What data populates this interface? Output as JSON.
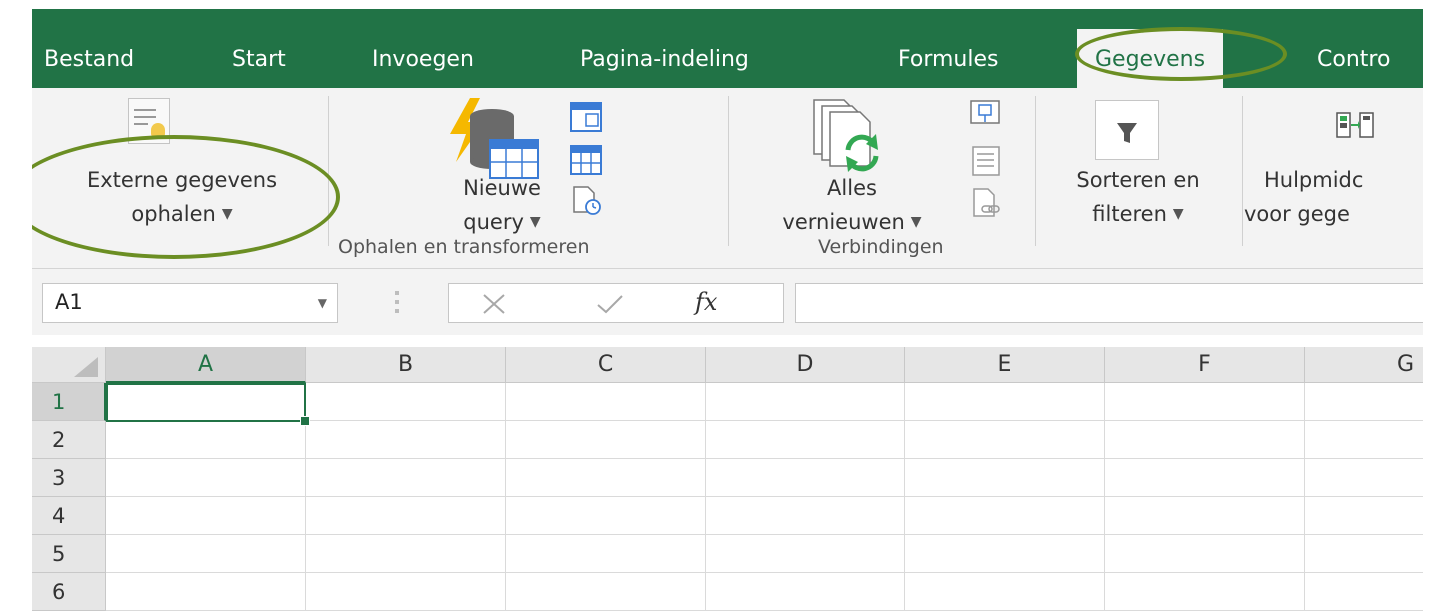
{
  "tabs": [
    {
      "label": "Bestand"
    },
    {
      "label": "Start"
    },
    {
      "label": "Invoegen"
    },
    {
      "label": "Pagina-indeling"
    },
    {
      "label": "Formules"
    },
    {
      "label": "Gegevens",
      "active": true
    },
    {
      "label": "Contro"
    }
  ],
  "ribbon": {
    "external": {
      "line1": "Externe gegevens",
      "line2": "ophalen"
    },
    "new_query": {
      "line1": "Nieuwe",
      "line2": "query"
    },
    "group_get_transform": "Ophalen en transformeren",
    "refresh": {
      "line1": "Alles",
      "line2": "vernieuwen"
    },
    "group_connections": "Verbindingen",
    "sort_filter": {
      "line1": "Sorteren en",
      "line2": "filteren"
    },
    "tools": {
      "line1": "Hulpmidc",
      "line2": "voor gege"
    }
  },
  "formula_bar": {
    "name_box": "A1",
    "fx_label": "fx",
    "formula_value": ""
  },
  "grid": {
    "columns": [
      "A",
      "B",
      "C",
      "D",
      "E",
      "F",
      "G"
    ],
    "rows": [
      "1",
      "2",
      "3",
      "4",
      "5",
      "6"
    ],
    "active_cell": "A1"
  },
  "colors": {
    "accent": "#217346",
    "annotation": "#6b8e23"
  }
}
